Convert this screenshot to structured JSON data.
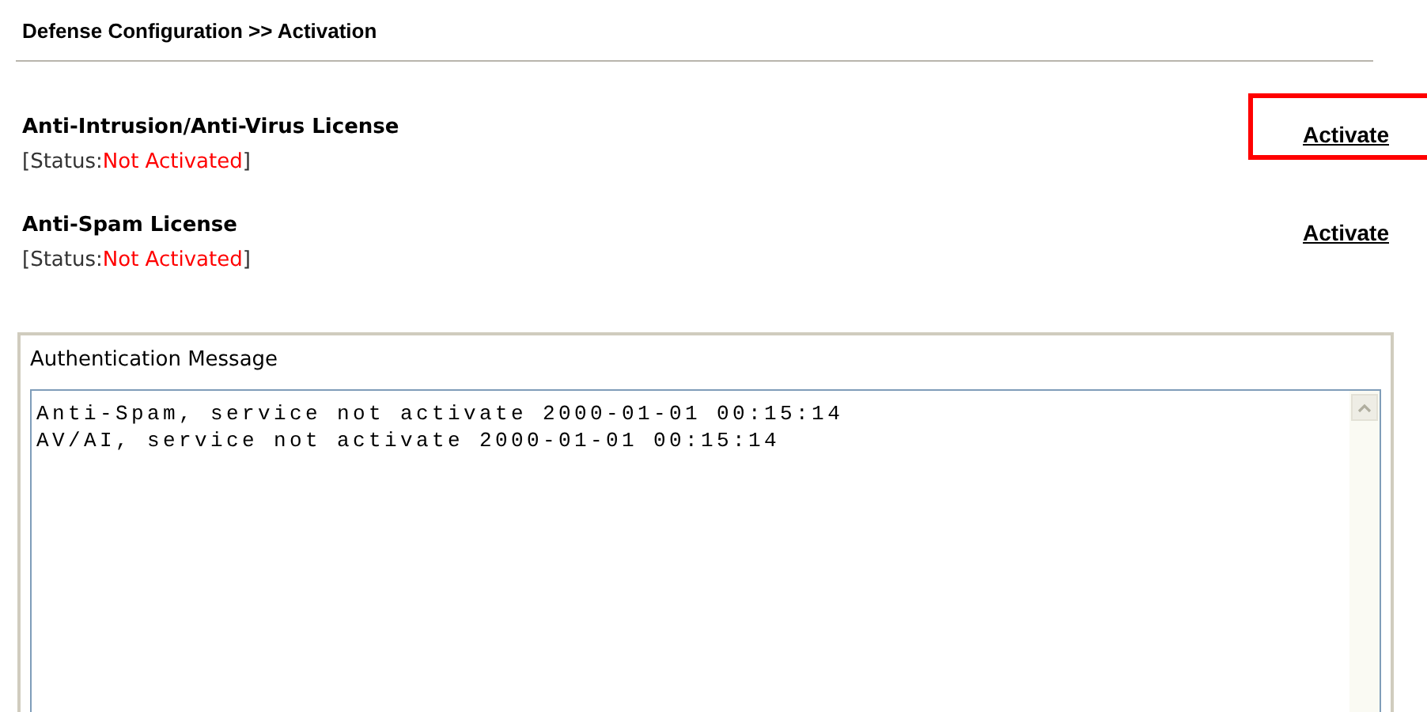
{
  "page_title": "Defense Configuration >> Activation",
  "licenses": [
    {
      "name": "Anti-Intrusion/Anti-Virus License",
      "status_prefix": "[Status:",
      "status": "Not Activated",
      "status_suffix": "]",
      "action": "Activate",
      "highlighted": true
    },
    {
      "name": "Anti-Spam License",
      "status_prefix": "[Status:",
      "status": "Not Activated",
      "status_suffix": "]",
      "action": "Activate",
      "highlighted": false
    }
  ],
  "message_panel": {
    "title": "Authentication Message",
    "lines": [
      "Anti-Spam, service not activate 2000-01-01 00:15:14",
      "AV/AI, service not activate 2000-01-01 00:15:14"
    ]
  }
}
